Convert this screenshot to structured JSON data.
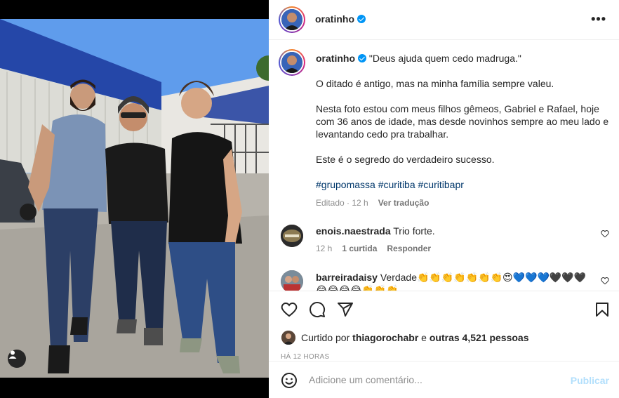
{
  "post": {
    "username": "oratinho",
    "more_icon": "more-horizontal-icon"
  },
  "caption": {
    "username": "oratinho",
    "quote": "\"Deus ajuda quem cedo madruga.\"",
    "p1": "O ditado é antigo, mas na minha família sempre valeu.",
    "p2": "Nesta foto estou com meus filhos gêmeos, Gabriel e Rafael, hoje com 36 anos de idade, mas desde novinhos sempre ao meu lado e levantando cedo pra trabalhar.",
    "p3": "Este é o segredo do verdadeiro sucesso.",
    "hashtags": "#grupomassa #curitiba #curitibapr",
    "edited": "Editado · 12 h",
    "see_translation": "Ver tradução"
  },
  "comments": [
    {
      "username": "enois.naestrada",
      "text": "Trio forte.",
      "time": "12 h",
      "likes": "1 curtida",
      "reply": "Responder"
    },
    {
      "username": "barreiradaisy",
      "text": "Verdade👏👏👏👏👏👏👏😍💙💙💙🖤🖤🖤",
      "text2": "😂😂😂😂👏👏👏"
    }
  ],
  "likes": {
    "prefix": "Curtido por",
    "user": "thiagorochabr",
    "mid": "e",
    "others": "outras 4,521 pessoas"
  },
  "time_ago": "HÁ 12 HORAS",
  "add_comment": {
    "placeholder": "Adicione um comentário...",
    "publish": "Publicar"
  },
  "colors": {
    "accent": "#0095f6",
    "link_dark": "#00376b",
    "muted": "#8e8e8e",
    "publish_disabled": "#b2dffc"
  }
}
